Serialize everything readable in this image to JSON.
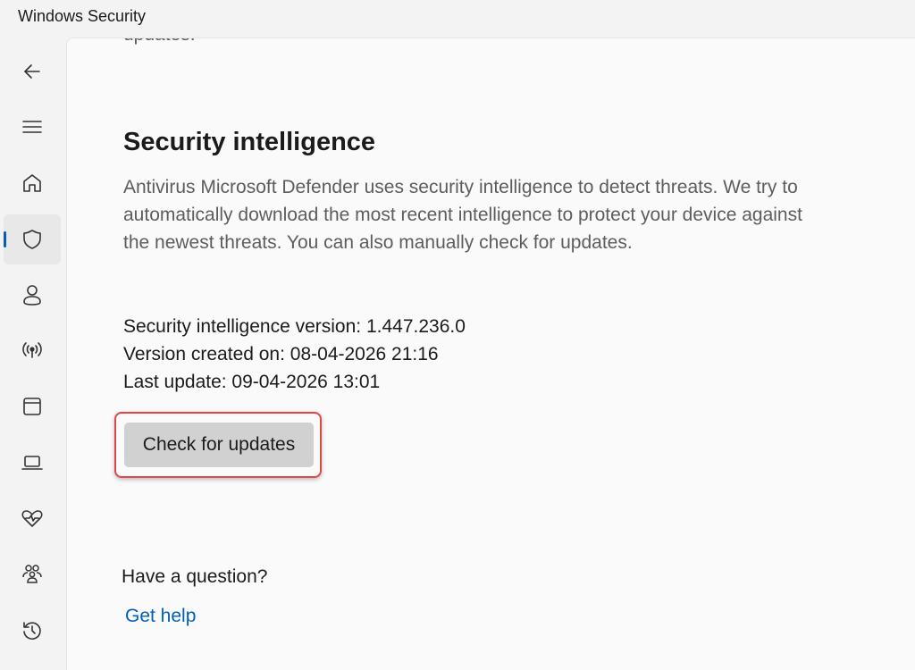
{
  "window": {
    "title": "Windows Security"
  },
  "sidebar": {
    "items": [
      {
        "name": "back",
        "icon": "back-arrow-icon"
      },
      {
        "name": "menu",
        "icon": "hamburger-menu-icon"
      },
      {
        "name": "home",
        "icon": "home-icon"
      },
      {
        "name": "virus-threat-protection",
        "icon": "shield-icon",
        "active": true
      },
      {
        "name": "account-protection",
        "icon": "person-icon"
      },
      {
        "name": "firewall-network-protection",
        "icon": "wifi-signal-icon"
      },
      {
        "name": "app-browser-control",
        "icon": "app-window-icon"
      },
      {
        "name": "device-security",
        "icon": "laptop-icon"
      },
      {
        "name": "device-performance-health",
        "icon": "heart-pulse-icon"
      },
      {
        "name": "family-options",
        "icon": "family-icon"
      },
      {
        "name": "protection-history",
        "icon": "history-icon"
      }
    ],
    "accent_color": "#005fb8"
  },
  "main": {
    "clipped_text": "updates.",
    "section": {
      "title": "Security intelligence",
      "description": "Antivirus Microsoft Defender uses security intelligence to detect threats. We try to automatically download the most recent intelligence to protect your device against the newest threats. You can also manually check for updates.",
      "version_line": "Security intelligence version: 1.447.236.0",
      "created_line": "Version created on: 08-04-2026 21:16",
      "last_update_line": "Last update: 09-04-2026 13:01",
      "button_label": "Check for updates",
      "highlight_color": "#e04848"
    },
    "help": {
      "question": "Have a question?",
      "link_label": "Get help"
    }
  }
}
